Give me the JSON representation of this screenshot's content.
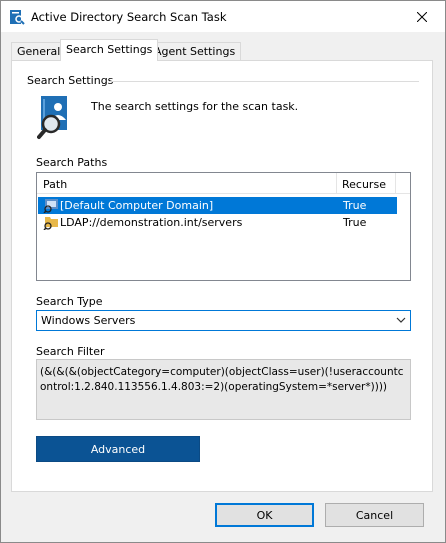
{
  "window": {
    "title": "Active Directory Search Scan Task"
  },
  "tabs": [
    {
      "label": "General",
      "active": false
    },
    {
      "label": "Search Settings",
      "active": true
    },
    {
      "label": "Agent Settings",
      "active": false
    }
  ],
  "search_settings": {
    "group_caption": "Search Settings",
    "description": "The search settings for the scan task."
  },
  "search_paths": {
    "label": "Search Paths",
    "columns": [
      "Path",
      "Recurse"
    ],
    "rows": [
      {
        "path": "[Default Computer Domain]",
        "recurse": "True",
        "selected": true
      },
      {
        "path": "LDAP://demonstration.int/servers",
        "recurse": "True",
        "selected": false
      }
    ]
  },
  "search_type": {
    "label": "Search Type",
    "value": "Windows Servers"
  },
  "search_filter": {
    "label": "Search Filter",
    "value": "(&(&(&(objectCategory=computer)(objectClass=user)(!useraccountcontrol:1.2.840.113556.1.4.803:=2)(operatingSystem=*server*))))"
  },
  "buttons": {
    "advanced": "Advanced",
    "ok": "OK",
    "cancel": "Cancel"
  },
  "colors": {
    "selection": "#0078d7",
    "advanced_button": "#0b5394",
    "filter_background": "#e8e8e8"
  }
}
